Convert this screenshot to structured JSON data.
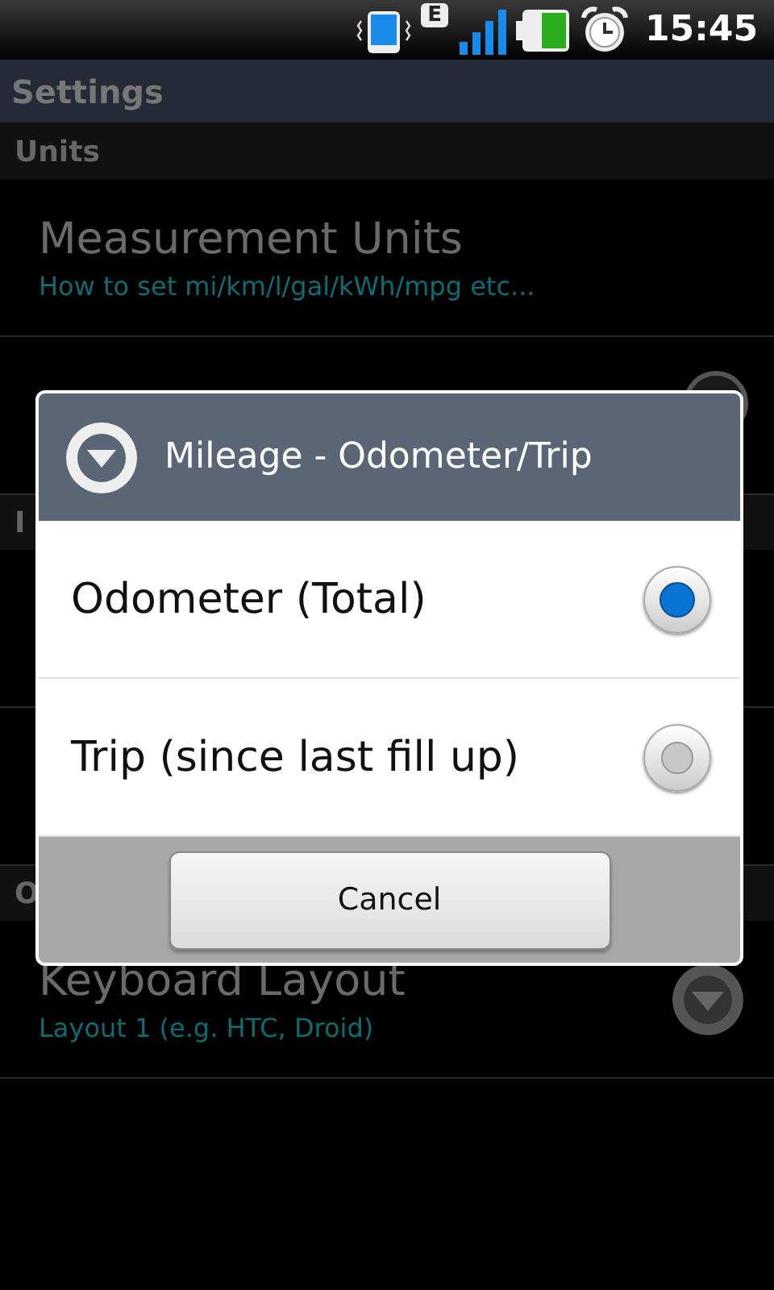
{
  "status_bar": {
    "network": "E",
    "time": "15:45"
  },
  "title_bar": {
    "title": "Settings"
  },
  "sections": [
    {
      "header": "Units",
      "items": [
        {
          "title": "Measurement Units",
          "summary": "How to set mi/km/l/gal/kWh/mpg etc..."
        },
        {
          "kind": "radio"
        }
      ]
    },
    {
      "header": "I",
      "items": [
        {
          "kind": "blank"
        },
        {
          "kind": "blank"
        }
      ]
    },
    {
      "header": "O",
      "items": [
        {
          "title": "Keyboard Layout",
          "summary": "Layout 1 (e.g. HTC, Droid)",
          "kind": "dropdown"
        }
      ]
    }
  ],
  "dialog": {
    "title": "Mileage - Odometer/Trip",
    "options": [
      {
        "label": "Odometer (Total)",
        "selected": true
      },
      {
        "label": "Trip (since last fill up)",
        "selected": false
      }
    ],
    "buttons": [
      "Cancel"
    ]
  }
}
